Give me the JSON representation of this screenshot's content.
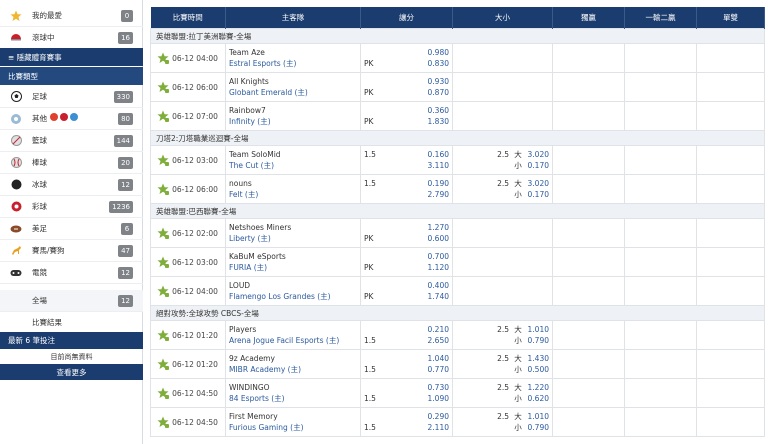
{
  "sidebar": {
    "my_favorites": {
      "label": "我的最愛",
      "count": "0"
    },
    "live": {
      "label": "滾球中",
      "count": "16"
    },
    "header_sport_events": "≡ 隱藏體育賽事",
    "header_categories": "比賽類型",
    "sports": [
      {
        "label": "足球",
        "count": "330",
        "icon": "soccer-ball-icon",
        "color": "#222222"
      },
      {
        "label": "其他",
        "count": "80",
        "icon": "other-sports-icon",
        "color": "#9bbad6"
      },
      {
        "label": "籃球",
        "count": "144",
        "icon": "basketball-icon",
        "color": "#e0e0e0"
      },
      {
        "label": "棒球",
        "count": "20",
        "icon": "baseball-icon",
        "color": "#e0e0e0"
      },
      {
        "label": "冰球",
        "count": "12",
        "icon": "ice-hockey-icon",
        "color": "#222222"
      },
      {
        "label": "彩球",
        "count": "1236",
        "icon": "lottery-ball-icon",
        "color": "#c8202f"
      },
      {
        "label": "美足",
        "count": "6",
        "icon": "american-football-icon",
        "color": "#8a4b2a"
      },
      {
        "label": "賽馬/賽狗",
        "count": "47",
        "icon": "horse-racing-icon",
        "color": "#e8a020"
      },
      {
        "label": "電競",
        "count": "12",
        "icon": "esports-icon",
        "color": "#333333"
      }
    ],
    "esports_sub": [
      {
        "label": "全場",
        "count": "12"
      },
      {
        "label": "比賽結果",
        "count": ""
      }
    ],
    "recent_bets_header": "最新 6 筆投注",
    "no_data": "目前尚無資料",
    "see_more": "查看更多"
  },
  "table": {
    "headers": [
      "比賽時間",
      "主客隊",
      "讓分",
      "大小",
      "獨贏",
      "一輸二贏",
      "單雙"
    ],
    "leagues": [
      {
        "name": "英雄聯盟:拉丁美洲聯賽-全場",
        "matches": [
          {
            "time": "06-12 04:00",
            "home": "Team Aze",
            "away": "Estral Esports (主)",
            "hdp_line": "",
            "hdp_home": "0.980",
            "hdp_away_line": "PK",
            "hdp_away": "0.830",
            "ou_line": "",
            "ou_over_tag": "",
            "ou_over": "",
            "ou_under_tag": "",
            "ou_under": ""
          },
          {
            "time": "06-12 06:00",
            "home": "All Knights",
            "away": "Globant Emerald (主)",
            "hdp_line": "",
            "hdp_home": "0.930",
            "hdp_away_line": "PK",
            "hdp_away": "0.870",
            "ou_line": "",
            "ou_over_tag": "",
            "ou_over": "",
            "ou_under_tag": "",
            "ou_under": ""
          },
          {
            "time": "06-12 07:00",
            "home": "Rainbow7",
            "away": "Infinity (主)",
            "hdp_line": "",
            "hdp_home": "0.360",
            "hdp_away_line": "PK",
            "hdp_away": "1.830",
            "ou_line": "",
            "ou_over_tag": "",
            "ou_over": "",
            "ou_under_tag": "",
            "ou_under": ""
          }
        ]
      },
      {
        "name": "刀塔2:刀塔職業巡迴賽-全場",
        "matches": [
          {
            "time": "06-12 03:00",
            "home": "Team SoloMid",
            "away": "The Cut (主)",
            "hdp_line": "1.5",
            "hdp_home": "0.160",
            "hdp_away_line": "",
            "hdp_away": "3.110",
            "ou_line": "2.5",
            "ou_over_tag": "大",
            "ou_over": "3.020",
            "ou_under_tag": "小",
            "ou_under": "0.170"
          },
          {
            "time": "06-12 06:00",
            "home": "nouns",
            "away": "Felt (主)",
            "hdp_line": "1.5",
            "hdp_home": "0.190",
            "hdp_away_line": "",
            "hdp_away": "2.790",
            "ou_line": "2.5",
            "ou_over_tag": "大",
            "ou_over": "3.020",
            "ou_under_tag": "小",
            "ou_under": "0.170"
          }
        ]
      },
      {
        "name": "英雄聯盟:巴西聯賽-全場",
        "matches": [
          {
            "time": "06-12 02:00",
            "home": "Netshoes Miners",
            "away": "Liberty (主)",
            "hdp_line": "",
            "hdp_home": "1.270",
            "hdp_away_line": "PK",
            "hdp_away": "0.600",
            "ou_line": "",
            "ou_over_tag": "",
            "ou_over": "",
            "ou_under_tag": "",
            "ou_under": ""
          },
          {
            "time": "06-12 03:00",
            "home": "KaBuM eSports",
            "away": "FURIA (主)",
            "hdp_line": "",
            "hdp_home": "0.700",
            "hdp_away_line": "PK",
            "hdp_away": "1.120",
            "ou_line": "",
            "ou_over_tag": "",
            "ou_over": "",
            "ou_under_tag": "",
            "ou_under": ""
          },
          {
            "time": "06-12 04:00",
            "home": "LOUD",
            "away": "Flamengo Los Grandes (主)",
            "hdp_line": "",
            "hdp_home": "0.400",
            "hdp_away_line": "PK",
            "hdp_away": "1.740",
            "ou_line": "",
            "ou_over_tag": "",
            "ou_over": "",
            "ou_under_tag": "",
            "ou_under": ""
          }
        ]
      },
      {
        "name": "絕對攻勢:全球攻勢 CBCS-全場",
        "matches": [
          {
            "time": "06-12 01:20",
            "home": "Players",
            "away": "Arena Jogue Facil Esports (主)",
            "hdp_line": "",
            "hdp_home": "0.210",
            "hdp_away_line": "1.5",
            "hdp_away": "2.650",
            "ou_line": "2.5",
            "ou_over_tag": "大",
            "ou_over": "1.010",
            "ou_under_tag": "小",
            "ou_under": "0.790"
          },
          {
            "time": "06-12 01:20",
            "home": "9z Academy",
            "away": "MIBR Academy (主)",
            "hdp_line": "",
            "hdp_home": "1.040",
            "hdp_away_line": "1.5",
            "hdp_away": "0.770",
            "ou_line": "2.5",
            "ou_over_tag": "大",
            "ou_over": "1.430",
            "ou_under_tag": "小",
            "ou_under": "0.500"
          },
          {
            "time": "06-12 04:50",
            "home": "WINDINGO",
            "away": "84 Esports (主)",
            "hdp_line": "",
            "hdp_home": "0.730",
            "hdp_away_line": "1.5",
            "hdp_away": "1.090",
            "ou_line": "2.5",
            "ou_over_tag": "大",
            "ou_over": "1.220",
            "ou_under_tag": "小",
            "ou_under": "0.620"
          },
          {
            "time": "06-12 04:50",
            "home": "First Memory",
            "away": "Furious Gaming (主)",
            "hdp_line": "",
            "hdp_home": "0.290",
            "hdp_away_line": "1.5",
            "hdp_away": "2.110",
            "ou_line": "2.5",
            "ou_over_tag": "大",
            "ou_over": "1.010",
            "ou_under_tag": "小",
            "ou_under": "0.790"
          }
        ]
      }
    ]
  },
  "colors": {
    "navy": "#1b3c6e",
    "link_blue": "#2b5a9e",
    "badge_gray": "#7f8388",
    "star_green": "#7fae3a"
  }
}
